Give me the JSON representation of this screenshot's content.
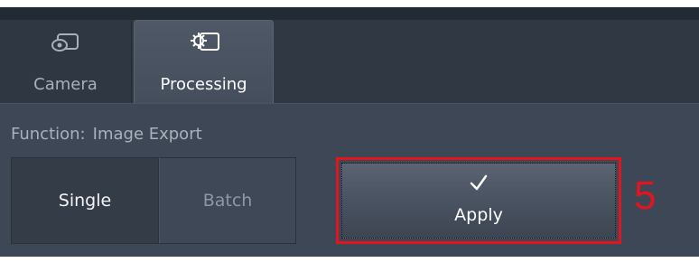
{
  "tabs": [
    {
      "label": "Camera",
      "icon": "camera-icon",
      "active": false
    },
    {
      "label": "Processing",
      "icon": "gear-window-icon",
      "active": true
    }
  ],
  "function": {
    "label": "Function:",
    "value": "Image Export"
  },
  "mode": {
    "single_label": "Single",
    "batch_label": "Batch",
    "selected": "Single"
  },
  "apply": {
    "label": "Apply",
    "icon": "checkmark-icon"
  },
  "callout": {
    "number": "5"
  },
  "colors": {
    "panel": "#3e4755",
    "highlight_red": "#e0151d",
    "text_active": "#ffffff",
    "text_inactive": "#a8b0bb"
  }
}
